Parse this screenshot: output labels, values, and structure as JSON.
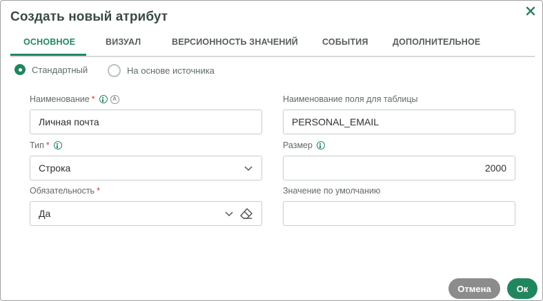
{
  "dialog": {
    "title": "Создать новый атрибут",
    "close_icon": "close-icon"
  },
  "tabs": [
    {
      "label": "ОСНОВНОЕ",
      "active": true
    },
    {
      "label": "ВИЗУАЛ",
      "active": false
    },
    {
      "label": "ВЕРСИОННОСТЬ ЗНАЧЕНИЙ",
      "active": false
    },
    {
      "label": "СОБЫТИЯ",
      "active": false
    },
    {
      "label": "ДОПОЛНИТЕЛЬНОЕ",
      "active": false
    }
  ],
  "source_mode": {
    "options": [
      {
        "label": "Стандартный",
        "checked": true
      },
      {
        "label": "На основе источника",
        "checked": false
      }
    ]
  },
  "form": {
    "name": {
      "label": "Наименование",
      "required_mark": "*",
      "value": "Личная почта"
    },
    "table_field_name": {
      "label": "Наименование поля для таблицы",
      "value": "PERSONAL_EMAIL"
    },
    "type": {
      "label": "Тип",
      "required_mark": "*",
      "value": "Строка"
    },
    "size": {
      "label": "Размер",
      "value": "2000"
    },
    "required": {
      "label": "Обязательность",
      "required_mark": "*",
      "value": "Да"
    },
    "default_value": {
      "label": "Значение по умолчанию",
      "value": ""
    }
  },
  "buttons": {
    "cancel": "Отмена",
    "ok": "Ок"
  },
  "colors": {
    "accent": "#21865e",
    "cancel_button": "#8c8c8c",
    "required_mark": "#d33a3a"
  }
}
